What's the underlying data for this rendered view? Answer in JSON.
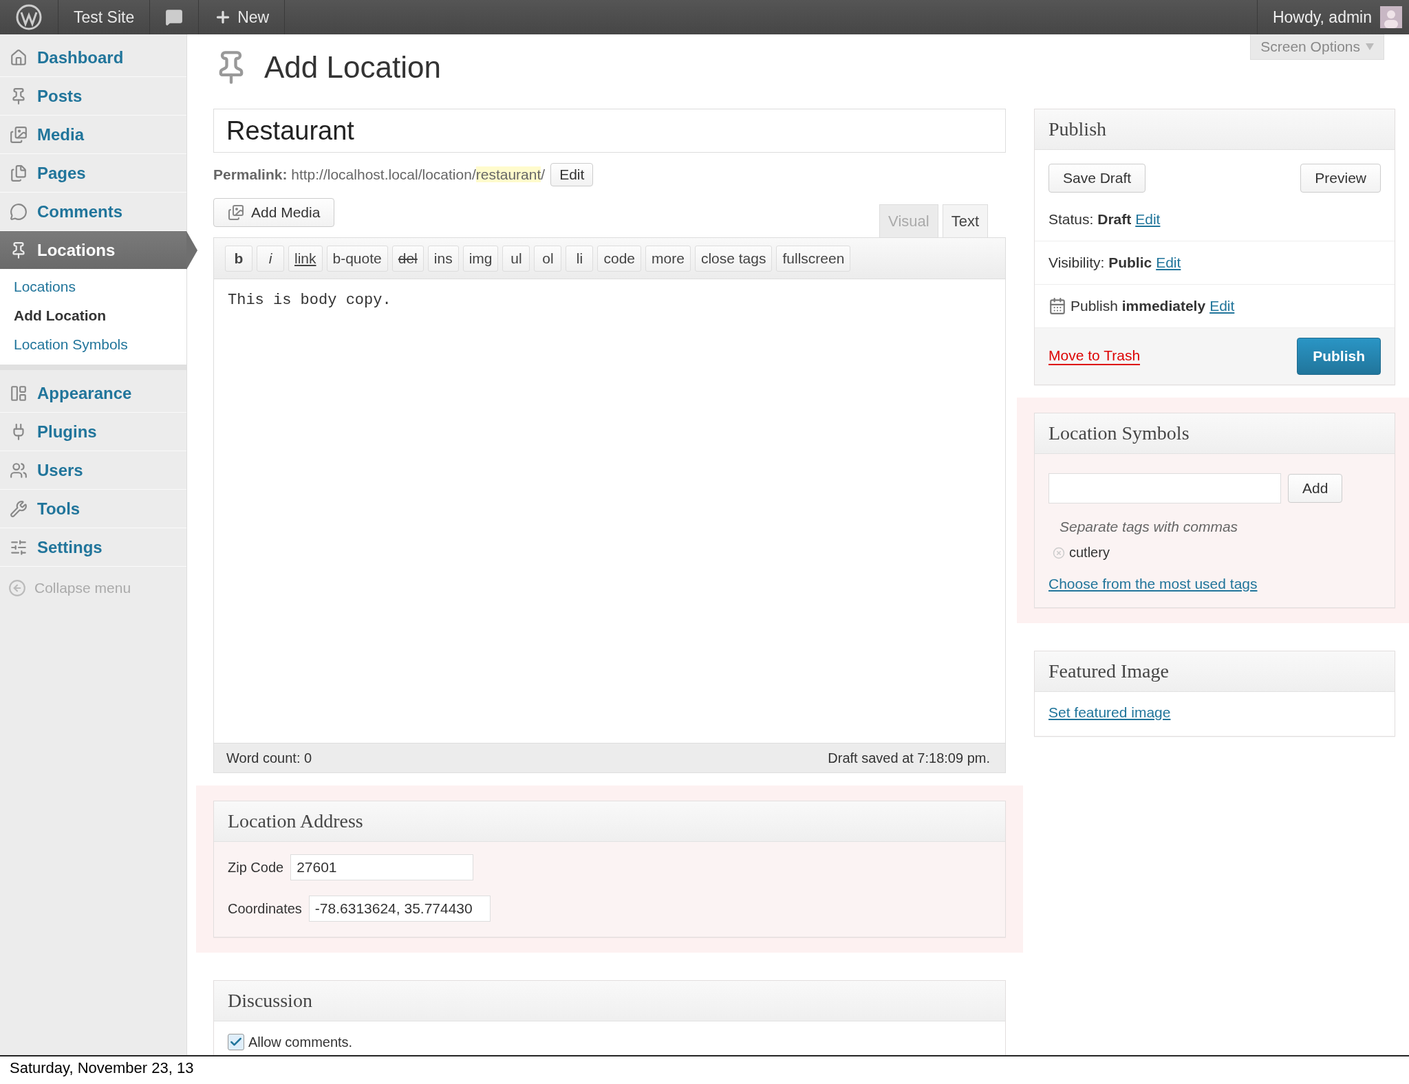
{
  "admin_bar": {
    "site_title": "Test Site",
    "new_label": "New",
    "greeting": "Howdy, admin"
  },
  "sidebar": {
    "items": [
      {
        "label": "Dashboard",
        "selected": false
      },
      {
        "label": "Posts",
        "selected": false
      },
      {
        "label": "Media",
        "selected": false
      },
      {
        "label": "Pages",
        "selected": false
      },
      {
        "label": "Comments",
        "selected": false
      },
      {
        "label": "Locations",
        "selected": true,
        "children": [
          {
            "label": "Locations",
            "selected": false
          },
          {
            "label": "Add Location",
            "selected": true
          },
          {
            "label": "Location Symbols",
            "selected": false
          }
        ]
      },
      {
        "label": "Appearance",
        "selected": false
      },
      {
        "label": "Plugins",
        "selected": false
      },
      {
        "label": "Users",
        "selected": false
      },
      {
        "label": "Tools",
        "selected": false
      },
      {
        "label": "Settings",
        "selected": false
      }
    ],
    "collapse_label": "Collapse menu"
  },
  "page": {
    "title": "Add Location",
    "screen_options": "Screen Options"
  },
  "post_title": "Restaurant",
  "permalink": {
    "label": "Permalink:",
    "base": "http://localhost.local/location/",
    "slug": "restaurant",
    "tail": "/",
    "edit_button": "Edit"
  },
  "editor": {
    "add_media": "Add Media",
    "tabs": [
      {
        "label": "Visual",
        "selected": false
      },
      {
        "label": "Text",
        "selected": true
      }
    ],
    "quicktags": [
      {
        "label": "b",
        "kind": "bold"
      },
      {
        "label": "i",
        "kind": "italic"
      },
      {
        "label": "link",
        "kind": "underline"
      },
      {
        "label": "b-quote",
        "kind": "plain"
      },
      {
        "label": "del",
        "kind": "strike"
      },
      {
        "label": "ins",
        "kind": "plain"
      },
      {
        "label": "img",
        "kind": "plain"
      },
      {
        "label": "ul",
        "kind": "plain"
      },
      {
        "label": "ol",
        "kind": "plain"
      },
      {
        "label": "li",
        "kind": "plain"
      },
      {
        "label": "code",
        "kind": "plain"
      },
      {
        "label": "more",
        "kind": "plain"
      },
      {
        "label": "close tags",
        "kind": "plain"
      },
      {
        "label": "fullscreen",
        "kind": "plain"
      }
    ],
    "body": "This is body copy.",
    "word_count": "Word count: 0",
    "draft_saved": "Draft saved at 7:18:09 pm."
  },
  "location_address": {
    "title": "Location Address",
    "highlighted": true,
    "fields": [
      {
        "label": "Zip Code",
        "value": "27601"
      },
      {
        "label": "Coordinates",
        "value": "-78.6313624, 35.774430"
      }
    ]
  },
  "discussion": {
    "title": "Discussion",
    "highlighted": false,
    "allow_comments": {
      "label": "Allow comments.",
      "checked": true
    }
  },
  "publish": {
    "title": "Publish",
    "save_draft": "Save Draft",
    "preview": "Preview",
    "rows": [
      {
        "kind": "status",
        "label": "Status:",
        "value": "Draft",
        "link": "Edit"
      },
      {
        "kind": "status",
        "label": "Visibility:",
        "value": "Public",
        "link": "Edit"
      },
      {
        "kind": "schedule",
        "label": "Publish",
        "value": "immediately",
        "link": "Edit"
      }
    ],
    "move_to_trash": "Move to Trash",
    "publish_button": "Publish"
  },
  "location_symbols": {
    "title": "Location Symbols",
    "highlighted": true,
    "add_button": "Add",
    "hint": "Separate tags with commas",
    "tags": [
      "cutlery"
    ],
    "choose_link": "Choose from the most used tags"
  },
  "featured_image": {
    "title": "Featured Image",
    "highlighted": false,
    "link": "Set featured image"
  },
  "footer_date": "Saturday, November 23, 13"
}
